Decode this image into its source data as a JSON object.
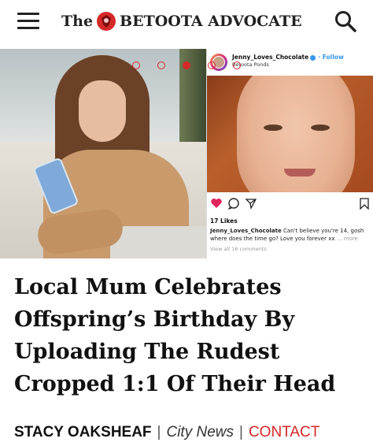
{
  "header": {
    "brand_prefix": "The",
    "brand_name": "BETOOTA ADVOCATE"
  },
  "hero": {
    "slides": [
      {
        "active": false
      },
      {
        "active": false
      },
      {
        "active": true
      },
      {
        "active": false
      },
      {
        "active": false
      }
    ],
    "instagram": {
      "username": "Jenny_Loves_Chocolate",
      "follow_label": "· Follow",
      "location": "Betoota Ponds",
      "likes": "17 Likes",
      "caption_user": "Jenny_Loves_Chocolate",
      "caption_text": "Can't believe you're 14, gosh where does the time go? Love you forever xx",
      "more_label": "... more",
      "comments_label": "View all 16 comments"
    }
  },
  "article": {
    "headline": "Local Mum Celebrates Offspring’s Birthday By Uploading The Rudest Cropped 1:1 Of Their Head",
    "author": "STACY OAKSHEAF",
    "separator": "|",
    "section": "City News",
    "contact_label": "CONTACT"
  },
  "colors": {
    "accent": "#d62828",
    "instagram_blue": "#3897f0",
    "text": "#111111"
  }
}
